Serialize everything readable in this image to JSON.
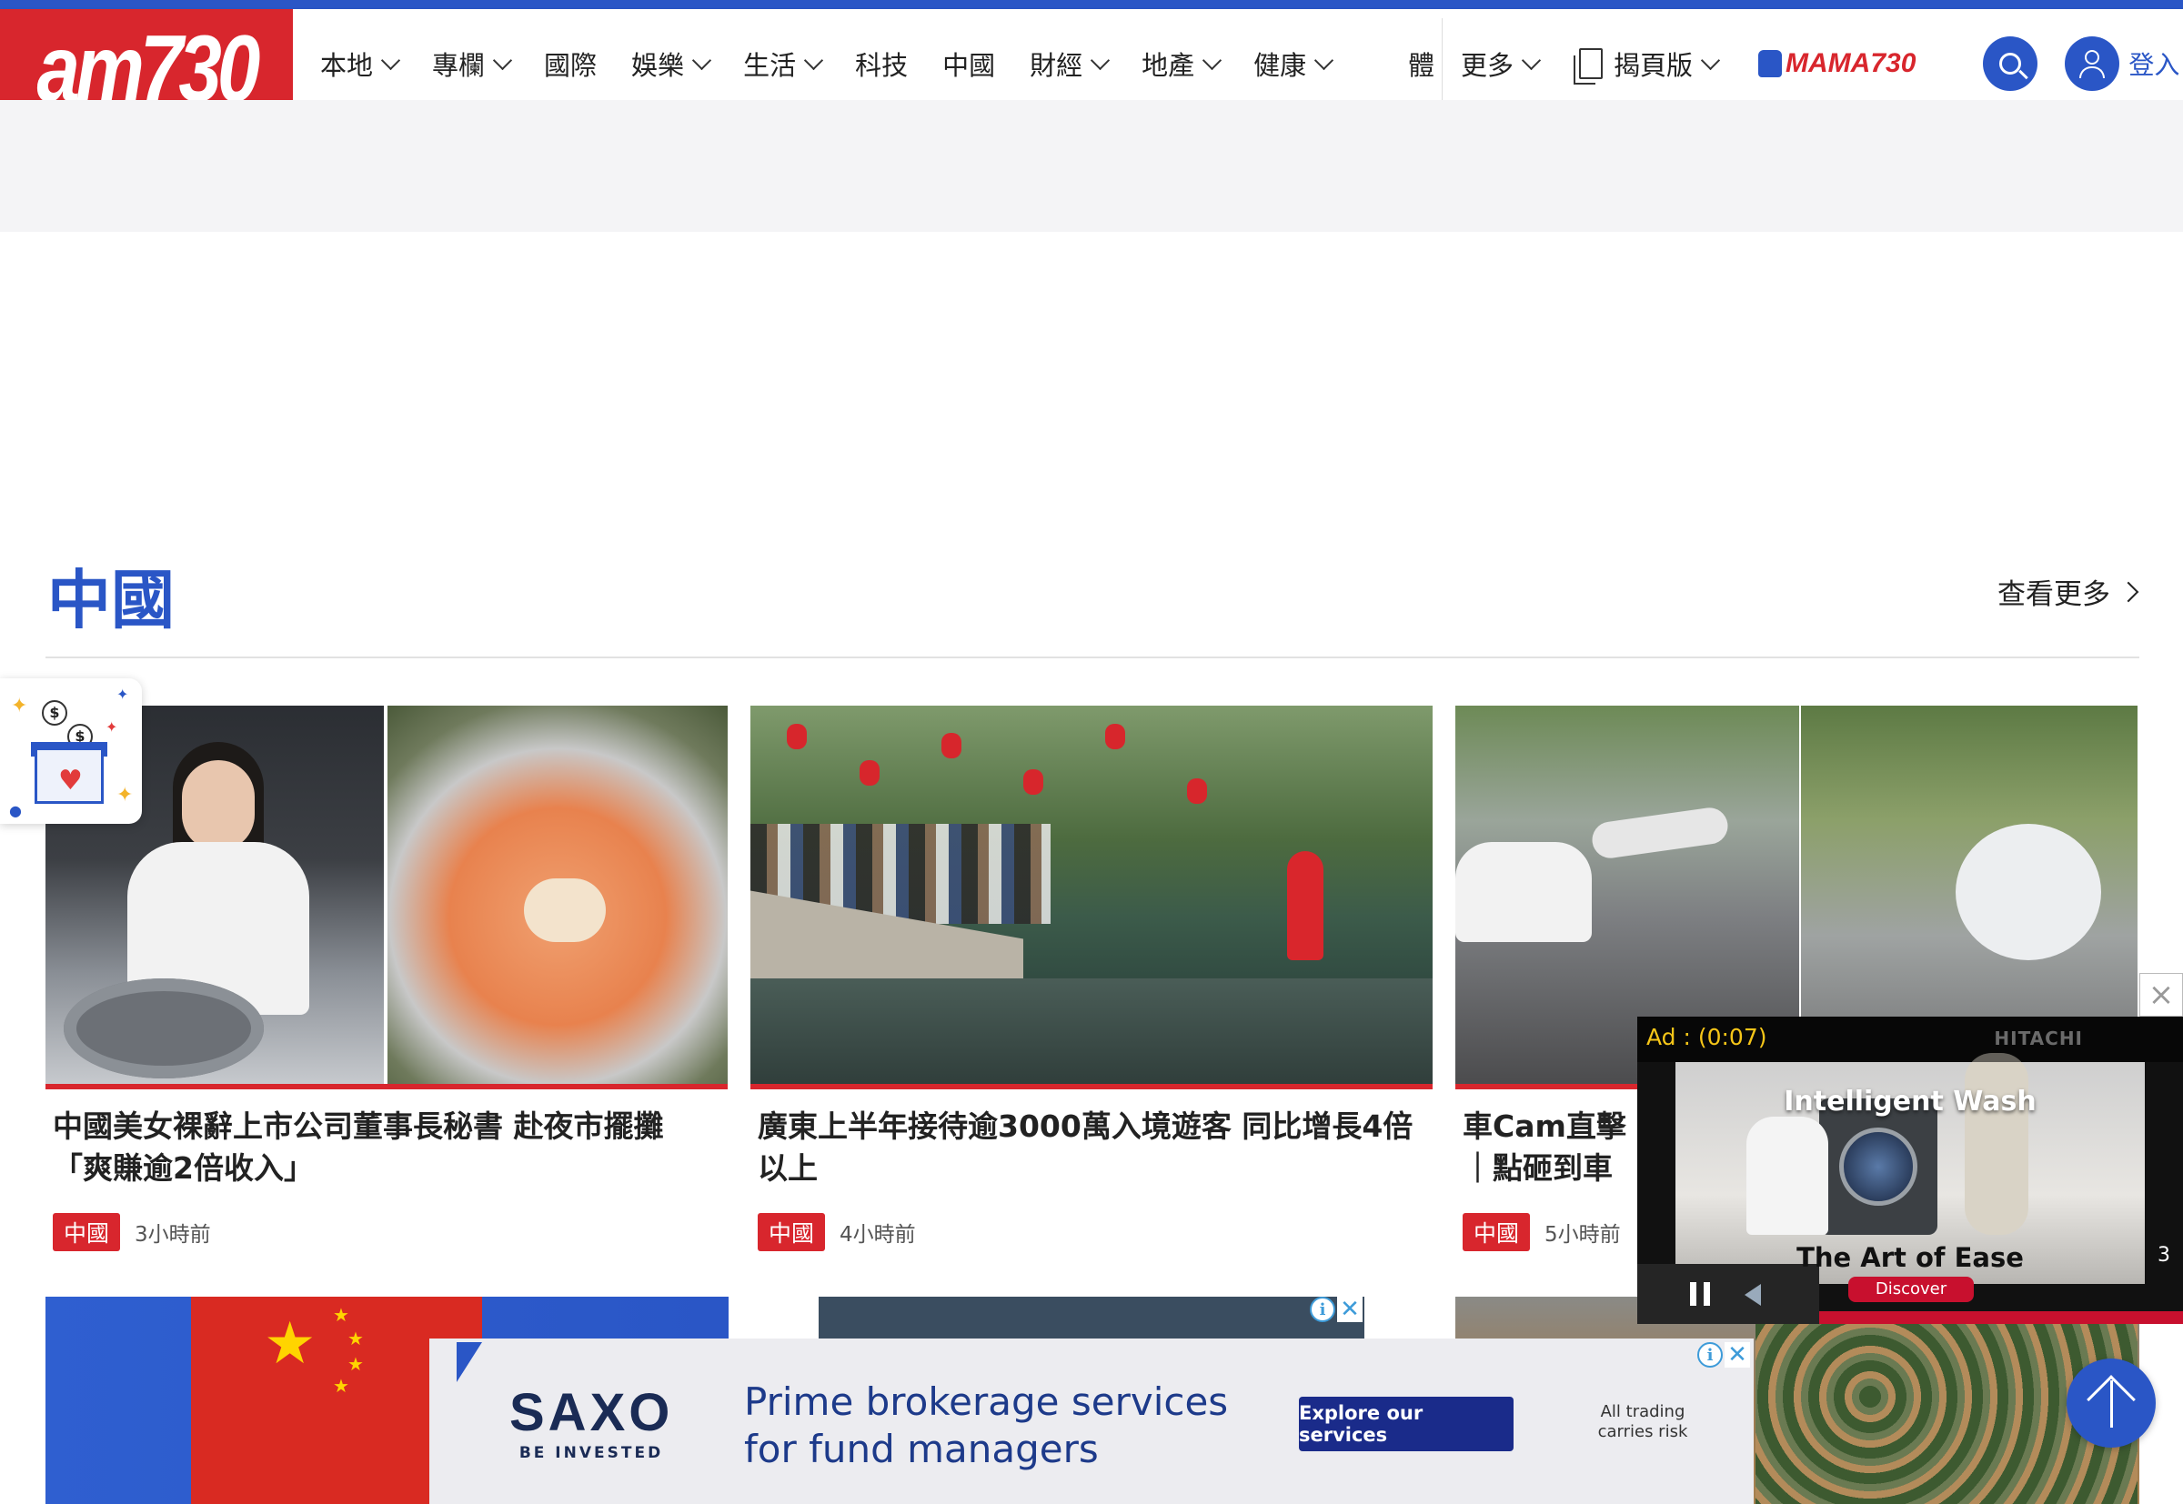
{
  "header": {
    "logo_text": "am730",
    "nav": [
      {
        "label": "本地",
        "has_dropdown": true
      },
      {
        "label": "專欄",
        "has_dropdown": true
      },
      {
        "label": "國際",
        "has_dropdown": false
      },
      {
        "label": "娛樂",
        "has_dropdown": true
      },
      {
        "label": "生活",
        "has_dropdown": true
      },
      {
        "label": "科技",
        "has_dropdown": false
      },
      {
        "label": "中國",
        "has_dropdown": false
      },
      {
        "label": "財經",
        "has_dropdown": true
      },
      {
        "label": "地產",
        "has_dropdown": true
      },
      {
        "label": "健康",
        "has_dropdown": true
      }
    ],
    "nav_truncated": "體",
    "more_label": "更多",
    "flipbook_label": "揭頁版",
    "mama_label": "MAMA730",
    "login_label": "登入",
    "accent_color": "#2a56c6",
    "brand_color": "#d8262d"
  },
  "section": {
    "title": "中國",
    "see_more": "查看更多"
  },
  "articles": [
    {
      "title": "中國美女裸辭上市公司董事長秘書 赴夜市擺攤「爽賺逾2倍收入」",
      "tag": "中國",
      "time": "3小時前"
    },
    {
      "title": "廣東上半年接待逾3000萬入境遊客 同比增長4倍以上",
      "tag": "中國",
      "time": "4小時前"
    },
    {
      "title": "車Cam直擊｜點砸到車",
      "tag": "中國",
      "time": "5小時前"
    }
  ],
  "video_ad": {
    "ad_timer": "Ad : (0:07)",
    "brand": "HITACHI",
    "headline": "Intelligent Wash",
    "subline": "The Art of Ease",
    "cta": "Discover",
    "counter": "3"
  },
  "bottom_ad": {
    "brand": "SAXO",
    "tagline": "BE INVESTED",
    "line1": "Prime brokerage services",
    "line2": "for fund managers",
    "cta": "Explore our services",
    "disclaimer_1": "All trading",
    "disclaimer_2": "carries risk"
  },
  "icons": {
    "search": "search-icon",
    "user": "user-icon",
    "back_to_top": "arrow-up-icon",
    "close": "close-icon",
    "ad_info": "info-icon"
  }
}
